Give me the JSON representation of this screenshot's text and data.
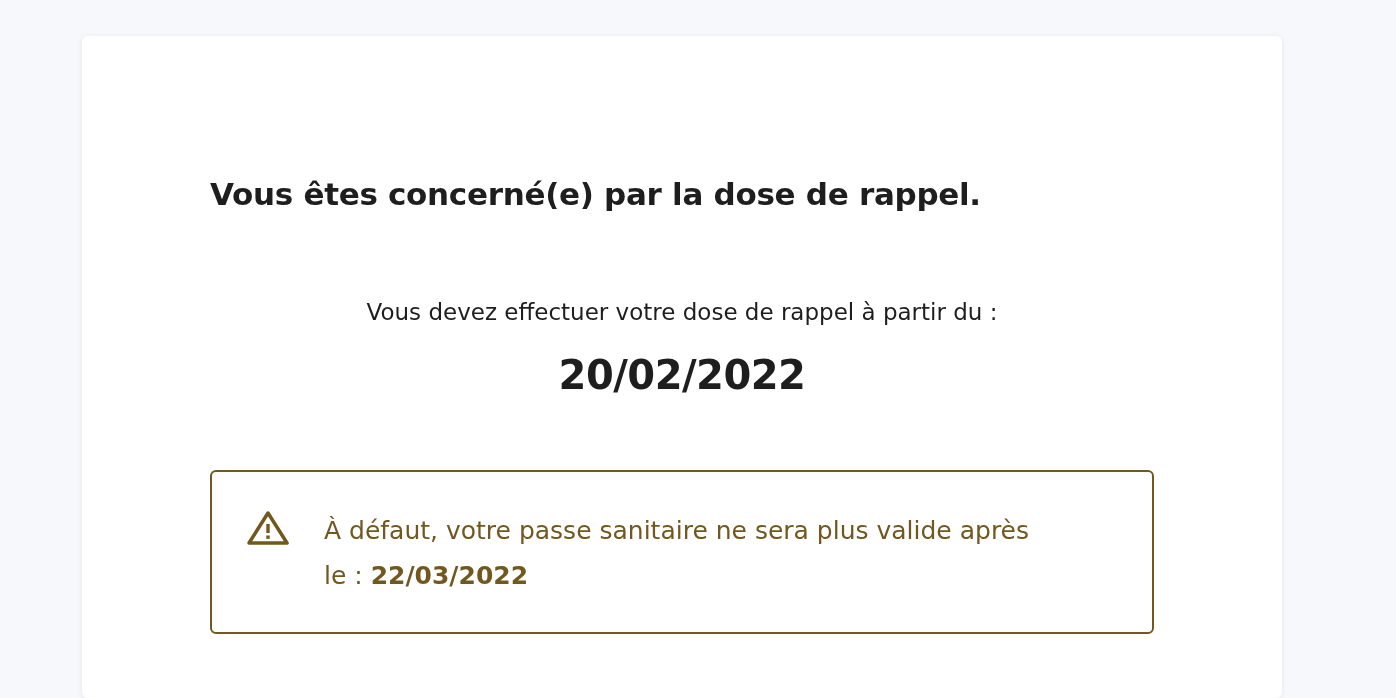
{
  "heading": "Vous êtes concerné(e) par la dose de rappel.",
  "instruction": "Vous devez effectuer votre dose de rappel à partir du :",
  "date": "20/02/2022",
  "alert": {
    "kind": "warning",
    "text": "À défaut, votre passe sanitaire ne sera plus valide après le : **22/03/2022**"
  }
}
